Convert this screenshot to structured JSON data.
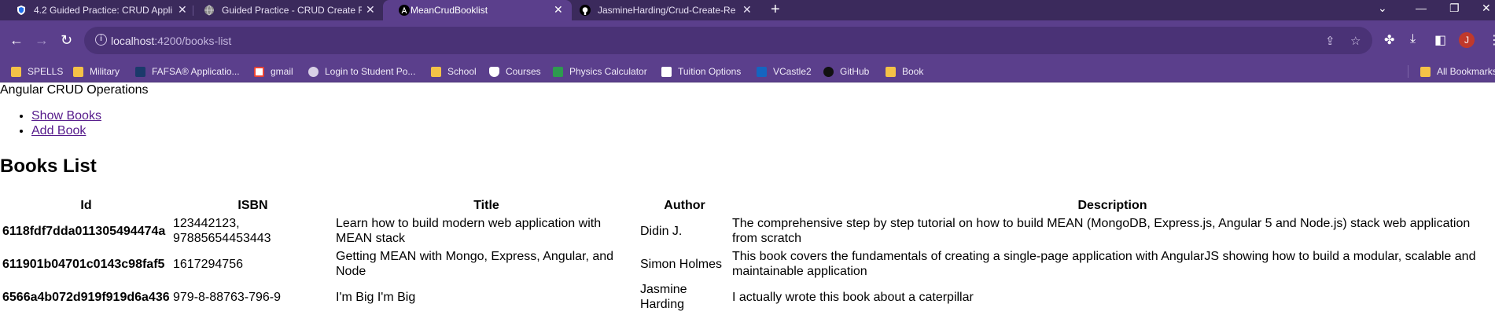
{
  "browser": {
    "tabs": [
      {
        "title": "4.2 Guided Practice: CRUD Appli",
        "icon": "shield-icon",
        "icon_color": "#1f6feb",
        "active": false
      },
      {
        "title": "Guided Practice - CRUD Create F",
        "icon": "globe-icon",
        "icon_color": "#8a8a8a",
        "active": false
      },
      {
        "title": "MeanCrudBooklist",
        "icon": "angular-icon",
        "icon_color": "#000000",
        "active": true
      },
      {
        "title": "JasmineHarding/Crud-Create-Re",
        "icon": "github-icon",
        "icon_color": "#000000",
        "active": false
      }
    ],
    "new_tab": "+",
    "window_controls": {
      "tab_search": "⌄",
      "minimize": "—",
      "restore": "❐",
      "close": "✕"
    },
    "address": {
      "host": "localhost",
      "path": ":4200/books-list"
    },
    "avatar_initial": "J",
    "bookmarks": [
      {
        "label": "SPELLS",
        "icon": "folder-icon"
      },
      {
        "label": "Military",
        "icon": "folder-icon"
      },
      {
        "label": "FAFSA® Applicatio...",
        "icon": "fafsa-icon"
      },
      {
        "label": "gmail",
        "icon": "gmail-icon"
      },
      {
        "label": "Login to Student Po...",
        "icon": "globe-icon"
      },
      {
        "label": "School",
        "icon": "folder-icon"
      },
      {
        "label": "Courses",
        "icon": "shield-icon"
      },
      {
        "label": "Physics Calculator",
        "icon": "sqrt-icon"
      },
      {
        "label": "Tuition Options",
        "icon": "document-icon"
      },
      {
        "label": "VCastle2",
        "icon": "n-icon"
      },
      {
        "label": "GitHub",
        "icon": "github-icon"
      },
      {
        "label": "Book",
        "icon": "folder-icon"
      },
      {
        "label": "All Bookmarks",
        "icon": "folder-icon"
      }
    ],
    "colors": {
      "frame": "#3b2a5c",
      "toolbar": "#5b3f8c",
      "omnibox": "#4a3276",
      "folder": "#f4c247"
    }
  },
  "app": {
    "title": "Angular CRUD Operations",
    "nav": {
      "show_books": "Show Books",
      "add_book": "Add Book"
    },
    "heading": "Books List",
    "columns": [
      "Id",
      "ISBN",
      "Title",
      "Author",
      "Description"
    ],
    "books": [
      {
        "id": "6118fdf7dda011305494474a",
        "isbn": "123442123, 97885654453443",
        "title": "Learn how to build modern web application with MEAN stack",
        "author": "Didin J.",
        "description": "The comprehensive step by step tutorial on how to build MEAN (MongoDB, Express.js, Angular 5 and Node.js) stack web application from scratch"
      },
      {
        "id": "611901b04701c0143c98faf5",
        "isbn": "1617294756",
        "title": "Getting MEAN with Mongo, Express, Angular, and Node",
        "author": "Simon Holmes",
        "description": "This book covers the fundamentals of creating a single-page application with AngularJS showing how to build a modular, scalable and maintainable application"
      },
      {
        "id": "6566a4b072d919f919d6a436",
        "isbn": "979-8-88763-796-9",
        "title": "I'm Big I'm Big",
        "author": "Jasmine Harding",
        "description": "I actually wrote this book about a caterpillar"
      }
    ]
  }
}
